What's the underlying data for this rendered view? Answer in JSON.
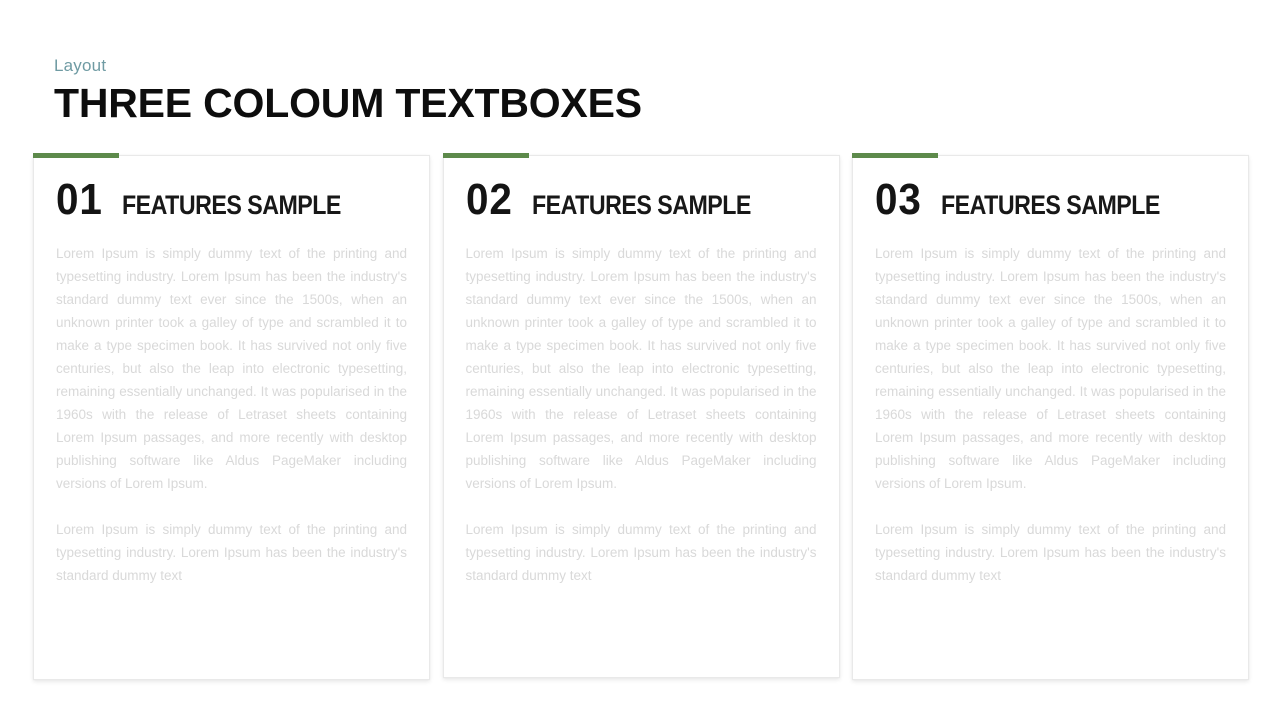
{
  "header": {
    "eyebrow": "Layout",
    "title": "THREE COLOUM TEXTBOXES"
  },
  "theme": {
    "accent_green": "#5d8a4b",
    "eyebrow_color": "#6f9ba3",
    "title_color": "#0d0d0d",
    "body_text_color": "#d9d9d9",
    "background": "#ffffff",
    "card_border": "#e9e9e9"
  },
  "cards": [
    {
      "number": "01",
      "title": "FEATURES SAMPLE",
      "paragraph1": "Lorem Ipsum is simply dummy text of the printing and typesetting industry. Lorem Ipsum has been the industry's standard dummy text ever since the 1500s, when an unknown printer took a galley of type and scrambled it to make a type specimen book. It has survived not only five centuries, but also the leap into electronic typesetting, remaining essentially unchanged. It was popularised in the 1960s with the release of Letraset sheets containing Lorem Ipsum passages, and more recently with desktop publishing software like Aldus PageMaker including versions of Lorem Ipsum.",
      "paragraph2": "Lorem Ipsum is simply dummy text of the printing and typesetting industry. Lorem Ipsum has been the industry's standard dummy text"
    },
    {
      "number": "02",
      "title": "FEATURES SAMPLE",
      "paragraph1": "Lorem Ipsum is simply dummy text of the printing and typesetting industry. Lorem Ipsum has been the industry's standard dummy text ever since the 1500s, when an unknown printer took a galley of type and scrambled it to make a type specimen book. It has survived not only five centuries, but also the leap into electronic typesetting, remaining essentially unchanged. It was popularised in the 1960s with the release of Letraset sheets containing Lorem Ipsum passages, and more recently with desktop publishing software like Aldus PageMaker including versions of Lorem Ipsum.",
      "paragraph2": "Lorem Ipsum is simply dummy text of the printing and typesetting industry. Lorem Ipsum has been the industry's standard dummy text"
    },
    {
      "number": "03",
      "title": "FEATURES SAMPLE",
      "paragraph1": "Lorem Ipsum is simply dummy text of the printing and typesetting industry. Lorem Ipsum has been the industry's standard dummy text ever since the 1500s, when an unknown printer took a galley of type and scrambled it to make a type specimen book. It has survived not only five centuries, but also the leap into electronic typesetting, remaining essentially unchanged. It was popularised in the 1960s with the release of Letraset sheets containing Lorem Ipsum passages, and more recently with desktop publishing software like Aldus PageMaker including versions of Lorem Ipsum.",
      "paragraph2": "Lorem Ipsum is simply dummy text of the printing and typesetting industry. Lorem Ipsum has been the industry's standard dummy text"
    }
  ]
}
